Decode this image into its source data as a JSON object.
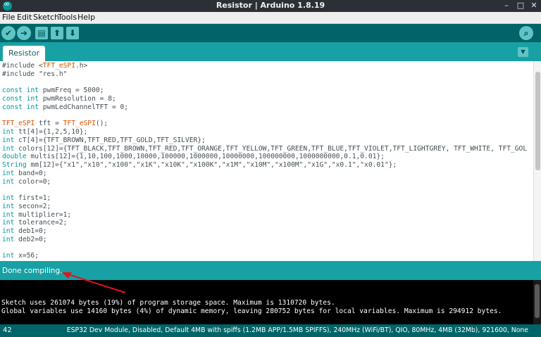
{
  "window": {
    "title": "Resistor | Arduino 1.8.19",
    "app_icon": "arduino-logo-icon"
  },
  "menu": {
    "items": [
      "File",
      "Edit",
      "Sketch",
      "Tools",
      "Help"
    ]
  },
  "toolbar": {
    "buttons": [
      {
        "name": "verify",
        "icon": "check-icon",
        "glyph": "✔"
      },
      {
        "name": "upload",
        "icon": "arrow-right-icon",
        "glyph": "➜"
      },
      {
        "name": "new",
        "icon": "new-file-icon",
        "glyph": "▤"
      },
      {
        "name": "open",
        "icon": "arrow-up-icon",
        "glyph": "⬆"
      },
      {
        "name": "save",
        "icon": "arrow-down-icon",
        "glyph": "⬇"
      }
    ],
    "serial_monitor_icon": "magnifier-icon",
    "serial_monitor_glyph": "⌕"
  },
  "tabs": {
    "active": "Resistor",
    "menu_glyph": "▼"
  },
  "editor": {
    "lines": [
      [
        {
          "t": "#include <"
        },
        {
          "t": "TFT_eSPI",
          "c": "ty"
        },
        {
          "t": ".h>"
        }
      ],
      [
        {
          "t": "#include \"res.h\""
        }
      ],
      [
        {
          "t": ""
        }
      ],
      [
        {
          "t": "const",
          "c": "kw"
        },
        {
          "t": " "
        },
        {
          "t": "int",
          "c": "kw"
        },
        {
          "t": " pwmFreq = 5000;"
        }
      ],
      [
        {
          "t": "const",
          "c": "kw"
        },
        {
          "t": " "
        },
        {
          "t": "int",
          "c": "kw"
        },
        {
          "t": " pwmResolution = 8;"
        }
      ],
      [
        {
          "t": "const",
          "c": "kw"
        },
        {
          "t": " "
        },
        {
          "t": "int",
          "c": "kw"
        },
        {
          "t": " pwmLedChannelTFT = 0;"
        }
      ],
      [
        {
          "t": ""
        }
      ],
      [
        {
          "t": "TFT_eSPI",
          "c": "ty"
        },
        {
          "t": " tft = "
        },
        {
          "t": "TFT_eSPI",
          "c": "ty"
        },
        {
          "t": "();"
        }
      ],
      [
        {
          "t": "int",
          "c": "kw"
        },
        {
          "t": " tt[4]={1,2,5,10};"
        }
      ],
      [
        {
          "t": "int",
          "c": "kw"
        },
        {
          "t": " cT[4]={TFT_BROWN,TFT_RED,TFT_GOLD,TFT_SILVER};"
        }
      ],
      [
        {
          "t": "int",
          "c": "kw"
        },
        {
          "t": " colors[12]={TFT_BLACK,TFT_BROWN,TFT_RED,TFT_ORANGE,TFT_YELLOW,TFT_GREEN,TFT_BLUE,TFT_VIOLET,TFT_LIGHTGREY, TFT_WHITE, TFT_GOL"
        }
      ],
      [
        {
          "t": "double",
          "c": "kw"
        },
        {
          "t": " multis[12]={1,10,100,1000,10000,100000,1000000,10000000,100000000,1000000000,0.1,0.01};"
        }
      ],
      [
        {
          "t": "String",
          "c": "kw"
        },
        {
          "t": " mm[12]={\"x1\",\"x10\",\"x100\",\"x1K\",\"x10K\",\"x100K\",\"x1M\",\"x10M\",\"x100M\",\"x1G\",\"x0.1\",\"x0.01\"};"
        }
      ],
      [
        {
          "t": "int",
          "c": "kw"
        },
        {
          "t": " band=0;"
        }
      ],
      [
        {
          "t": "int",
          "c": "kw"
        },
        {
          "t": " color=0;"
        }
      ],
      [
        {
          "t": ""
        }
      ],
      [
        {
          "t": "int",
          "c": "kw"
        },
        {
          "t": " first=1;"
        }
      ],
      [
        {
          "t": "int",
          "c": "kw"
        },
        {
          "t": " secon=2;"
        }
      ],
      [
        {
          "t": "int",
          "c": "kw"
        },
        {
          "t": " multiplier=1;"
        }
      ],
      [
        {
          "t": "int",
          "c": "kw"
        },
        {
          "t": " tolerance=2;"
        }
      ],
      [
        {
          "t": "int",
          "c": "kw"
        },
        {
          "t": " deb1=0;"
        }
      ],
      [
        {
          "t": "int",
          "c": "kw"
        },
        {
          "t": " deb2=0;"
        }
      ],
      [
        {
          "t": ""
        }
      ],
      [
        {
          "t": "int",
          "c": "kw"
        },
        {
          "t": " x=56;"
        }
      ]
    ]
  },
  "status": {
    "message": "Done compiling."
  },
  "console": {
    "lines": [
      "Sketch uses 261074 bytes (19%) of program storage space. Maximum is 1310720 bytes.",
      "Global variables use 14160 bytes (4%) of dynamic memory, leaving 280752 bytes for local variables. Maximum is 294912 bytes."
    ]
  },
  "bottom": {
    "line_number": "42",
    "board_info": "ESP32 Dev Module, Disabled, Default 4MB with spiffs (1.2MB APP/1.5MB SPIFFS), 240MHz (WiFi/BT), QIO, 80MHz, 4MB (32Mb), 921600, None"
  },
  "annotation": {
    "arrow_color": "#e0141e"
  }
}
